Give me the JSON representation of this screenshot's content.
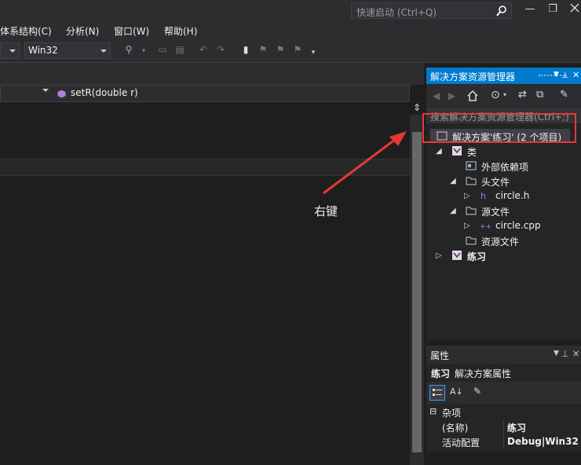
{
  "titlebar": {
    "quick_launch_placeholder": "快速启动 (Ctrl+Q)",
    "minimize": "—",
    "restore": "❐"
  },
  "menu": [
    "体系结构(C)",
    "分析(N)",
    "窗口(W)",
    "帮助(H)"
  ],
  "toolbar": {
    "config_value": "",
    "platform_value": "Win32"
  },
  "editor": {
    "member_dropdown": "setR(double r)"
  },
  "solution_explorer": {
    "title": "解决方案资源管理器",
    "search_placeholder": "搜索解决方案资源管理器(Ctrl+;)",
    "items": [
      {
        "label": "解决方案'练习' (2 个项目)",
        "expander": "",
        "icon": "solution-icon"
      },
      {
        "label": "类",
        "expander": "◢",
        "icon": "class-icon"
      },
      {
        "label": "外部依赖项",
        "expander": "",
        "icon": "references-icon"
      },
      {
        "label": "头文件",
        "expander": "◢",
        "icon": "folder-icon"
      },
      {
        "label": "circle.h",
        "expander": "▷",
        "icon": "header-file-icon"
      },
      {
        "label": "源文件",
        "expander": "◢",
        "icon": "folder-icon"
      },
      {
        "label": "circle.cpp",
        "expander": "▷",
        "icon": "cpp-file-icon"
      },
      {
        "label": "资源文件",
        "expander": "",
        "icon": "folder-icon"
      },
      {
        "label": "练习",
        "expander": "▷",
        "icon": "project-icon"
      }
    ]
  },
  "annotation": {
    "text": "右键",
    "color": "#e53935"
  },
  "properties": {
    "title": "属性",
    "object_name": "练习",
    "object_type": "解决方案属性",
    "category": "杂项",
    "rows": [
      {
        "key": "(名称)",
        "value": "练习"
      },
      {
        "key": "活动配置",
        "value": "Debug|Win32"
      }
    ]
  },
  "colors": {
    "accent": "#007acc",
    "background": "#1e1e1e",
    "chrome": "#2d2d30"
  }
}
